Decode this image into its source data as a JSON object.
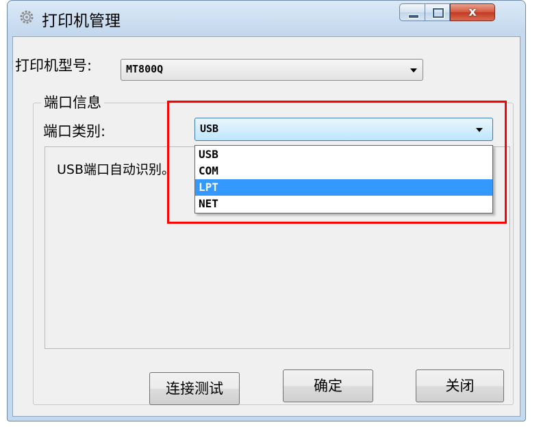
{
  "window": {
    "title": "打印机管理",
    "controls": {
      "close_glyph": "x"
    }
  },
  "form": {
    "model_label": "打印机型号:",
    "model_value": "MT800Q",
    "port_group_title": "端口信息",
    "port_type_label": "端口类别:",
    "port_type_value": "USB",
    "auto_detect_text": "USB端口自动识别。"
  },
  "dropdown": {
    "options": [
      {
        "label": "USB",
        "selected": false
      },
      {
        "label": "COM",
        "selected": false
      },
      {
        "label": "LPT",
        "selected": true
      },
      {
        "label": "NET",
        "selected": false
      }
    ]
  },
  "buttons": {
    "test": "连接测试",
    "ok": "确定",
    "close": "关闭"
  },
  "colors": {
    "highlight_box": "#ff0000",
    "selection": "#3399ff"
  },
  "icons": [
    "settings-icon",
    "minimize-icon",
    "maximize-icon",
    "close-icon",
    "chevron-down-icon"
  ]
}
